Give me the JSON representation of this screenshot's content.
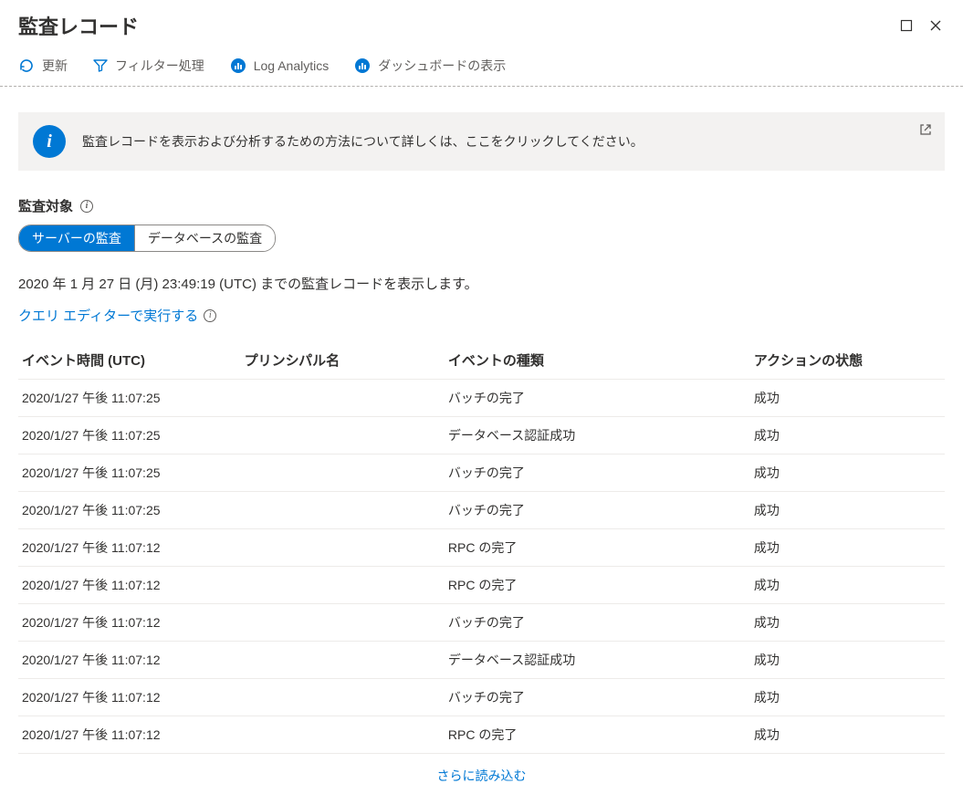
{
  "header": {
    "title": "監査レコード"
  },
  "toolbar": {
    "refresh": "更新",
    "filter": "フィルター処理",
    "log_analytics": "Log Analytics",
    "dashboard": "ダッシュボードの表示"
  },
  "banner": {
    "text": "監査レコードを表示および分析するための方法について詳しくは、ここをクリックしてください。"
  },
  "audit_target": {
    "label": "監査対象",
    "server": "サーバーの監査",
    "database": "データベースの監査"
  },
  "meta": {
    "timestamp_line": "2020 年 1 月 27 日 (月) 23:49:19 (UTC) までの監査レコードを表示します。",
    "query_editor_link": "クエリ エディターで実行する"
  },
  "table": {
    "columns": {
      "time": "イベント時間 (UTC)",
      "principal": "プリンシパル名",
      "event": "イベントの種類",
      "status": "アクションの状態"
    },
    "rows": [
      {
        "time": "2020/1/27 午後 11:07:25",
        "principal": "",
        "event": "バッチの完了",
        "status": "成功"
      },
      {
        "time": "2020/1/27 午後 11:07:25",
        "principal": "",
        "event": "データベース認証成功",
        "status": "成功"
      },
      {
        "time": "2020/1/27 午後 11:07:25",
        "principal": "",
        "event": "バッチの完了",
        "status": "成功"
      },
      {
        "time": "2020/1/27 午後 11:07:25",
        "principal": "",
        "event": "バッチの完了",
        "status": "成功"
      },
      {
        "time": "2020/1/27 午後 11:07:12",
        "principal": "",
        "event": "RPC の完了",
        "status": "成功"
      },
      {
        "time": "2020/1/27 午後 11:07:12",
        "principal": "",
        "event": "RPC の完了",
        "status": "成功"
      },
      {
        "time": "2020/1/27 午後 11:07:12",
        "principal": "",
        "event": "バッチの完了",
        "status": "成功"
      },
      {
        "time": "2020/1/27 午後 11:07:12",
        "principal": "",
        "event": "データベース認証成功",
        "status": "成功"
      },
      {
        "time": "2020/1/27 午後 11:07:12",
        "principal": "",
        "event": "バッチの完了",
        "status": "成功"
      },
      {
        "time": "2020/1/27 午後 11:07:12",
        "principal": "",
        "event": "RPC の完了",
        "status": "成功"
      }
    ],
    "load_more": "さらに読み込む"
  }
}
